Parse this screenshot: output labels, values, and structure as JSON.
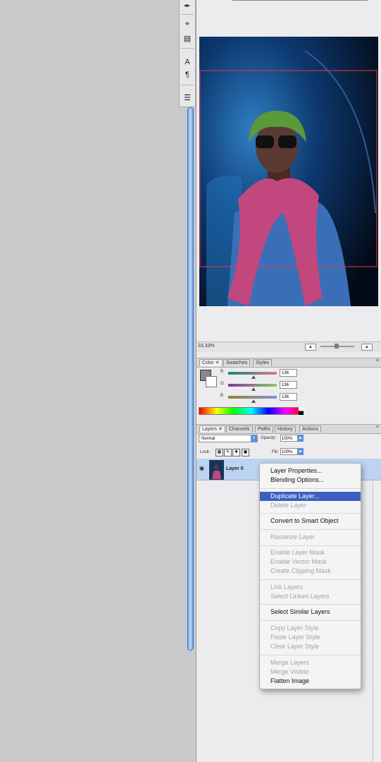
{
  "navigator": {
    "zoom": "33,33%"
  },
  "color_panel": {
    "tabs": [
      "Color",
      "Swatches",
      "Styles"
    ],
    "channels": [
      {
        "label": "R",
        "value": "136"
      },
      {
        "label": "G",
        "value": "136"
      },
      {
        "label": "B",
        "value": "136"
      }
    ]
  },
  "layers_panel": {
    "tabs": [
      "Layers",
      "Channels",
      "Paths",
      "History",
      "Actions"
    ],
    "blend_mode": "Normal",
    "opacity_label": "Opacity:",
    "opacity_value": "100%",
    "lock_label": "Lock:",
    "fill_label": "Fill:",
    "fill_value": "100%",
    "layer_name": "Layer 0"
  },
  "context_menu": {
    "items": [
      {
        "label": "Layer Properties...",
        "enabled": true
      },
      {
        "label": "Blending Options...",
        "enabled": true
      },
      {
        "label": "Duplicate Layer...",
        "enabled": true,
        "highlighted": true
      },
      {
        "label": "Delete Layer",
        "enabled": false
      },
      {
        "label": "Convert to Smart Object",
        "enabled": true
      },
      {
        "label": "Rasterize Layer",
        "enabled": false
      },
      {
        "label": "Enable Layer Mask",
        "enabled": false
      },
      {
        "label": "Enable Vector Mask",
        "enabled": false
      },
      {
        "label": "Create Clipping Mask",
        "enabled": false
      },
      {
        "label": "Link Layers",
        "enabled": false
      },
      {
        "label": "Select Linked Layers",
        "enabled": false
      },
      {
        "label": "Select Similar Layers",
        "enabled": true
      },
      {
        "label": "Copy Layer Style",
        "enabled": false
      },
      {
        "label": "Paste Layer Style",
        "enabled": false
      },
      {
        "label": "Clear Layer Style",
        "enabled": false
      },
      {
        "label": "Merge Layers",
        "enabled": false
      },
      {
        "label": "Merge Visible",
        "enabled": false
      },
      {
        "label": "Flatten Image",
        "enabled": true
      }
    ]
  }
}
